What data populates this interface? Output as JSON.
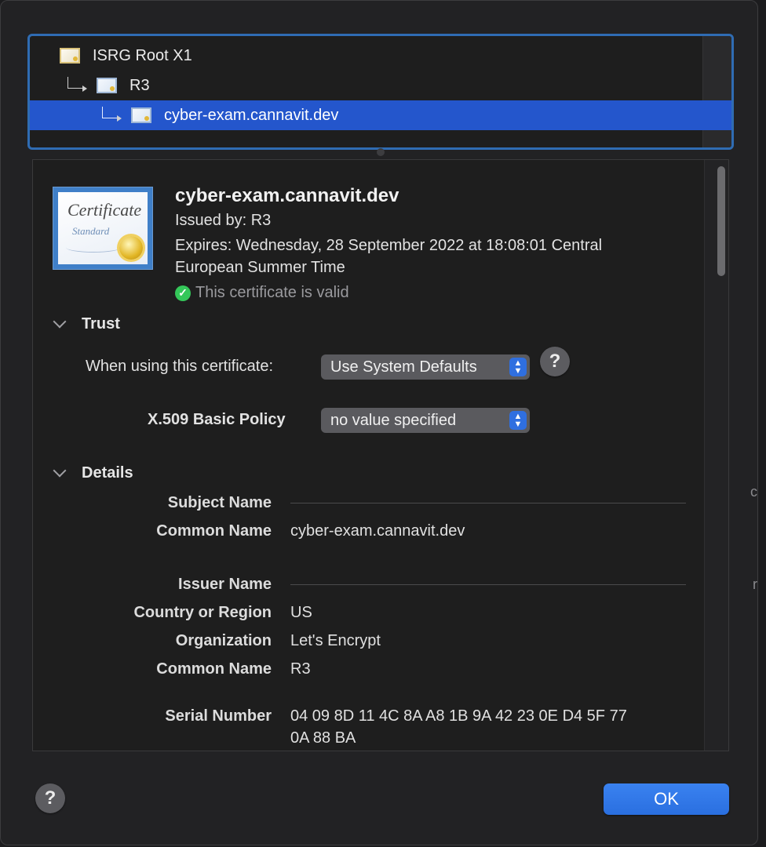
{
  "chain": {
    "items": [
      {
        "label": "ISRG Root X1",
        "icon": "certificate-icon"
      },
      {
        "label": "R3",
        "icon": "certificate-icon"
      },
      {
        "label": "cyber-exam.cannavit.dev",
        "icon": "certificate-icon",
        "selected": true
      }
    ]
  },
  "certificate": {
    "icon_script": "Certificate",
    "icon_subtitle": "Standard",
    "title": "cyber-exam.cannavit.dev",
    "issued_by": "Issued by: R3",
    "expires_line1": "Expires: Wednesday, 28 September 2022 at 18:08:01 Central",
    "expires_line2": "European Summer Time",
    "status": "This certificate is valid"
  },
  "trust": {
    "heading": "Trust",
    "when_using_label": "When using this certificate:",
    "when_using_value": "Use System Defaults",
    "policy_label": "X.509 Basic Policy",
    "policy_value": "no value specified",
    "help_glyph": "?"
  },
  "details": {
    "heading": "Details",
    "subject_name_label": "Subject Name",
    "subject_common_name_label": "Common Name",
    "subject_common_name_value": "cyber-exam.cannavit.dev",
    "issuer_name_label": "Issuer Name",
    "country_label": "Country or Region",
    "country_value": "US",
    "organization_label": "Organization",
    "organization_value": "Let's Encrypt",
    "issuer_common_name_label": "Common Name",
    "issuer_common_name_value": "R3",
    "serial_label": "Serial Number",
    "serial_value_line1": "04 09 8D 11 4C 8A A8 1B 9A 42 23 0E D4 5F 77",
    "serial_value_line2": "0A 88 BA"
  },
  "footer": {
    "help_glyph": "?",
    "ok_label": "OK"
  },
  "colors": {
    "accent": "#2456cc",
    "ok_button": "#2f76ea",
    "valid_check": "#34c759"
  }
}
